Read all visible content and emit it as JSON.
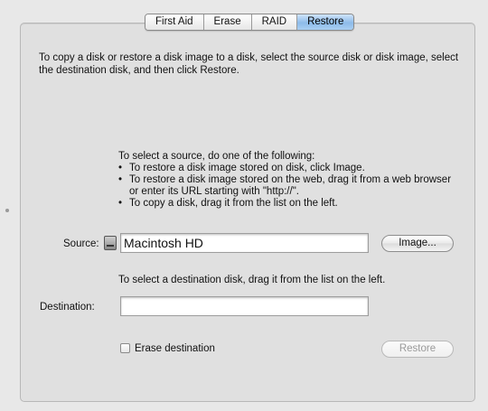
{
  "tabs": [
    {
      "label": "First Aid"
    },
    {
      "label": "Erase"
    },
    {
      "label": "RAID"
    },
    {
      "label": "Restore",
      "selected": true
    }
  ],
  "intro": "To copy a disk or restore a disk image to a disk, select the source disk or disk image, select the destination disk, and then click Restore.",
  "instructions": {
    "heading": "To select a source, do one of the following:",
    "items": [
      "To restore a disk image stored on disk, click Image.",
      "To restore a disk image stored on the web, drag it from a web browser or enter its URL starting with \"http://\".",
      "To copy a disk, drag it from the list on the left."
    ]
  },
  "source": {
    "label": "Source:",
    "value": "Macintosh HD",
    "icon": "hard-disk-icon",
    "image_button": "Image..."
  },
  "destination": {
    "hint": "To select a destination disk, drag it from the list on the left.",
    "label": "Destination:",
    "value": ""
  },
  "erase_destination": {
    "label": "Erase destination",
    "checked": false
  },
  "restore_button": {
    "label": "Restore",
    "enabled": false
  },
  "colors": {
    "selected_tab": "#8dbbe9",
    "panel": "#e0e0e0",
    "disabled_text": "#9a9a9a"
  }
}
